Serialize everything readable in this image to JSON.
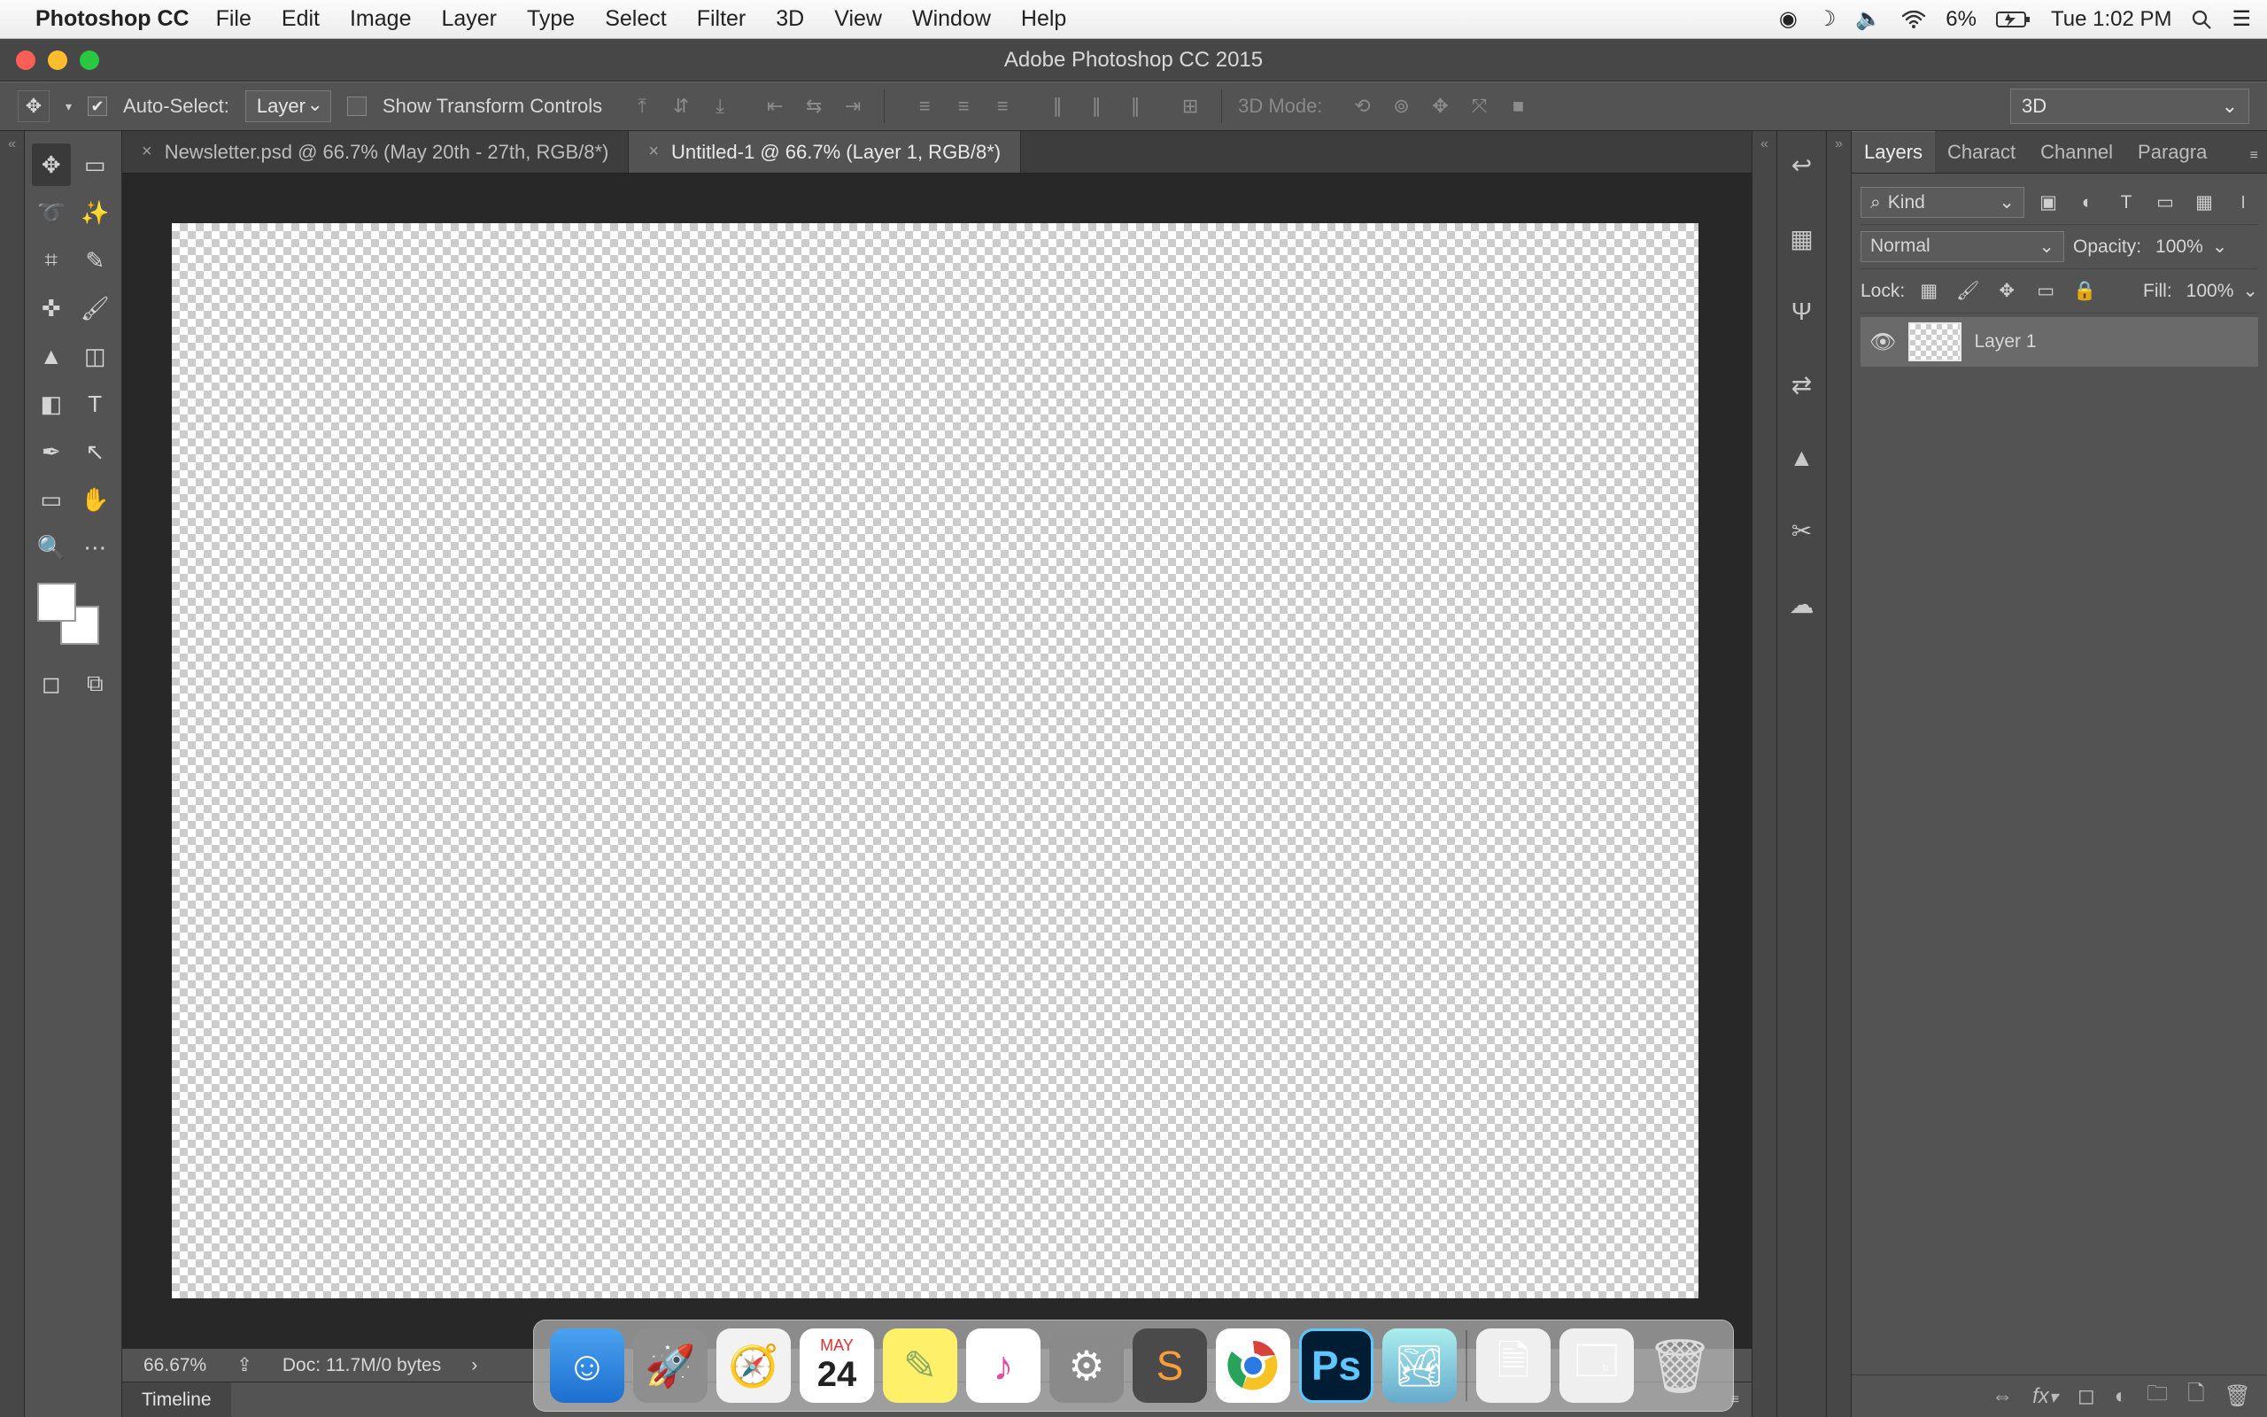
{
  "mac_menu": {
    "app_name": "Photoshop CC",
    "items": [
      "File",
      "Edit",
      "Image",
      "Layer",
      "Type",
      "Select",
      "Filter",
      "3D",
      "View",
      "Window",
      "Help"
    ],
    "battery": "6%",
    "clock": "Tue 1:02 PM"
  },
  "window_title": "Adobe Photoshop CC 2015",
  "options": {
    "auto_select_label": "Auto-Select:",
    "auto_select_value": "Layer",
    "show_transform": "Show Transform Controls",
    "mode_3d": "3D Mode:",
    "right_drop": "3D"
  },
  "doc_tabs": [
    {
      "title": "Newsletter.psd @ 66.7% (May 20th - 27th, RGB/8*)"
    },
    {
      "title": "Untitled-1 @ 66.7% (Layer 1, RGB/8*)"
    }
  ],
  "status": {
    "zoom": "66.67%",
    "doc_info": "Doc: 11.7M/0 bytes"
  },
  "timeline_label": "Timeline",
  "panel_tabs": [
    "Layers",
    "Charact",
    "Channel",
    "Paragra"
  ],
  "layers": {
    "kind": "Kind",
    "blend_mode": "Normal",
    "opacity_label": "Opacity:",
    "opacity_value": "100%",
    "lock_label": "Lock:",
    "fill_label": "Fill:",
    "fill_value": "100%",
    "items": [
      {
        "name": "Layer 1"
      }
    ]
  },
  "dock_cal": {
    "month": "MAY",
    "day": "24"
  }
}
